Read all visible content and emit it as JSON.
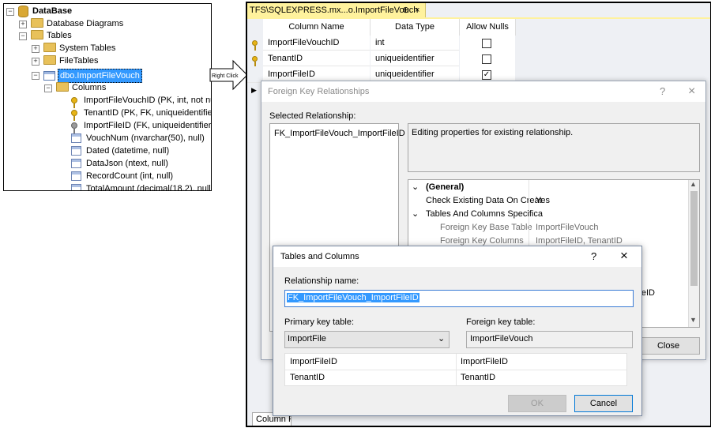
{
  "tree": {
    "root": "DataBase",
    "diagrams": "Database Diagrams",
    "tables": "Tables",
    "system_tables": "System Tables",
    "file_tables": "FileTables",
    "selected_table": "dbo.ImportFileVouch",
    "columns_folder": "Columns",
    "columns": [
      "ImportFileVouchID (PK, int, not nul",
      "TenantID (PK, FK, uniqueidentifier,",
      "ImportFileID (FK, uniqueidentifier, n",
      "VouchNum (nvarchar(50), null)",
      "Dated (datetime, null)",
      "DataJson (ntext, null)",
      "RecordCount (int, null)",
      "TotalAmount (decimal(18,2), null)"
    ]
  },
  "arrow_label": "Right Click",
  "designer": {
    "tab_title": "TFS\\SQLEXPRESS.mx...o.ImportFileVouch",
    "tab_pin": "⊕",
    "tab_close": "×",
    "headers": [
      "Column Name",
      "Data Type",
      "Allow Nulls"
    ],
    "rows": [
      {
        "name": "ImportFileVouchID",
        "type": "int",
        "nulls": false,
        "key": true
      },
      {
        "name": "TenantID",
        "type": "uniqueidentifier",
        "nulls": false,
        "key": true
      },
      {
        "name": "ImportFileID",
        "type": "uniqueidentifier",
        "nulls": true,
        "key": false
      }
    ],
    "bottom_tab": "Column Properties"
  },
  "fk_dialog": {
    "title": "Foreign Key Relationships",
    "help": "?",
    "close_x": "×",
    "selected_label": "Selected Relationship:",
    "relationship": "FK_ImportFileVouch_ImportFileID",
    "description": "Editing properties for existing relationship.",
    "props": {
      "general": "(General)",
      "check_existing": "Check Existing Data On Creat",
      "check_value": "Yes",
      "tables_columns": "Tables And Columns Specifica",
      "fk_base_table": "Foreign Key Base Table",
      "fk_base_value": "ImportFileVouch",
      "fk_columns": "Foreign Key Columns",
      "fk_columns_value": "ImportFileID, TenantID",
      "partial_value": "ileID"
    },
    "close_button": "Close"
  },
  "tc_dialog": {
    "title": "Tables and Columns",
    "help": "?",
    "close_x": "×",
    "relationship_label": "Relationship name:",
    "relationship_value": "FK_ImportFileVouch_ImportFileID",
    "pk_label": "Primary key table:",
    "pk_value": "ImportFile",
    "fk_label": "Foreign key table:",
    "fk_value": "ImportFileVouch",
    "mappings": [
      {
        "pk": "ImportFileID",
        "fk": "ImportFileID"
      },
      {
        "pk": "TenantID",
        "fk": "TenantID"
      }
    ],
    "ok": "OK",
    "cancel": "Cancel"
  }
}
